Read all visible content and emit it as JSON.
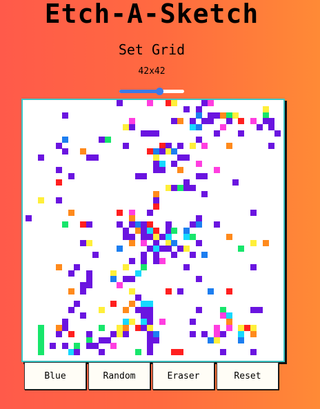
{
  "app": {
    "title": "Etch-A-Sketch",
    "subtitle": "Set Grid",
    "grid_size_label": "42x42"
  },
  "slider": {
    "level_fraction": 0.63,
    "color": "#3b7ae8"
  },
  "grid": {
    "size": 42,
    "background": "#ffffff",
    "border_color": "#3cc4c4",
    "palette": [
      "#6a14e0",
      "#ff1f1f",
      "#17e66b",
      "#ff3ee0",
      "#16d8ff",
      "#ffef3a",
      "#ff8a1c",
      "#1c7ef0"
    ]
  },
  "buttons": [
    {
      "id": "blue",
      "label": "Blue"
    },
    {
      "id": "random",
      "label": "Random"
    },
    {
      "id": "eraser",
      "label": "Eraser"
    },
    {
      "id": "reset",
      "label": "Reset"
    }
  ]
}
